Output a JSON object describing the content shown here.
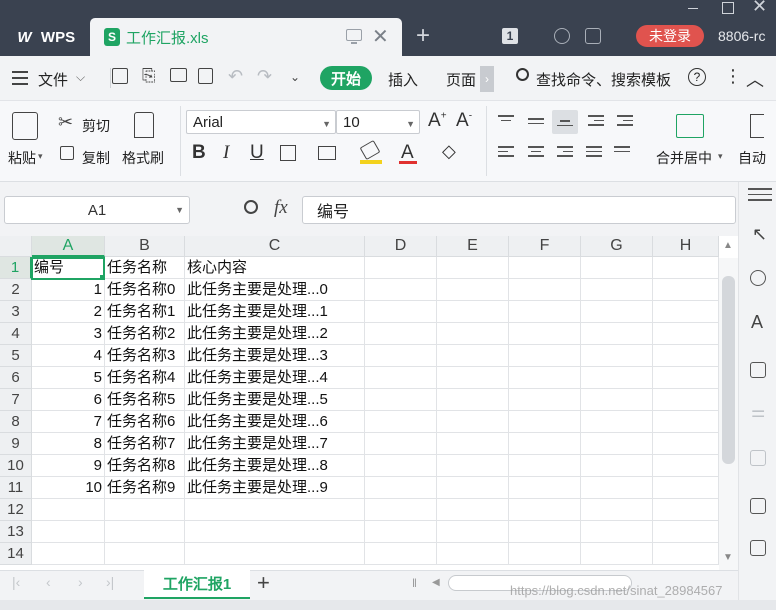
{
  "titlebar": {
    "app_label": "WPS",
    "doc_tab_icon": "S",
    "doc_title": "工作汇报.xls",
    "page_count": "1",
    "login_label": "未登录",
    "user_id": "8806-rc"
  },
  "menubar": {
    "file_label": "文件",
    "tabs": [
      "开始",
      "插入",
      "页面"
    ],
    "search_label": "查找命令、搜索模板"
  },
  "ribbon": {
    "paste_label": "粘贴",
    "cut_label": "剪切",
    "copy_label": "复制",
    "format_painter_label": "格式刷",
    "font_name": "Arial",
    "font_size": "10",
    "bold": "B",
    "italic": "I",
    "underline": "U",
    "merge_label": "合并居中",
    "auto_label": "自动"
  },
  "formula_bar": {
    "name_box": "A1",
    "fx_label": "fx",
    "content": "编号"
  },
  "sheet": {
    "columns": [
      "A",
      "B",
      "C",
      "D",
      "E",
      "F",
      "G",
      "H"
    ],
    "row_numbers": [
      "1",
      "2",
      "3",
      "4",
      "5",
      "6",
      "7",
      "8",
      "9",
      "10",
      "11",
      "12",
      "13",
      "14"
    ],
    "rows": [
      [
        "编号",
        "任务名称",
        "核心内容"
      ],
      [
        "1",
        "任务名称0",
        "此任务主要是处理...0"
      ],
      [
        "2",
        "任务名称1",
        "此任务主要是处理...1"
      ],
      [
        "3",
        "任务名称2",
        "此任务主要是处理...2"
      ],
      [
        "4",
        "任务名称3",
        "此任务主要是处理...3"
      ],
      [
        "5",
        "任务名称4",
        "此任务主要是处理...4"
      ],
      [
        "6",
        "任务名称5",
        "此任务主要是处理...5"
      ],
      [
        "7",
        "任务名称6",
        "此任务主要是处理...6"
      ],
      [
        "8",
        "任务名称7",
        "此任务主要是处理...7"
      ],
      [
        "9",
        "任务名称8",
        "此任务主要是处理...8"
      ],
      [
        "10",
        "任务名称9",
        "此任务主要是处理...9"
      ]
    ]
  },
  "sheet_tabs": {
    "active": "工作汇报1",
    "add_label": "+"
  },
  "watermark": "https://blog.csdn.net/sinat_28984567",
  "colors": {
    "accent": "#1fa463",
    "titlebar": "#3a4250",
    "login": "#e0534e"
  }
}
